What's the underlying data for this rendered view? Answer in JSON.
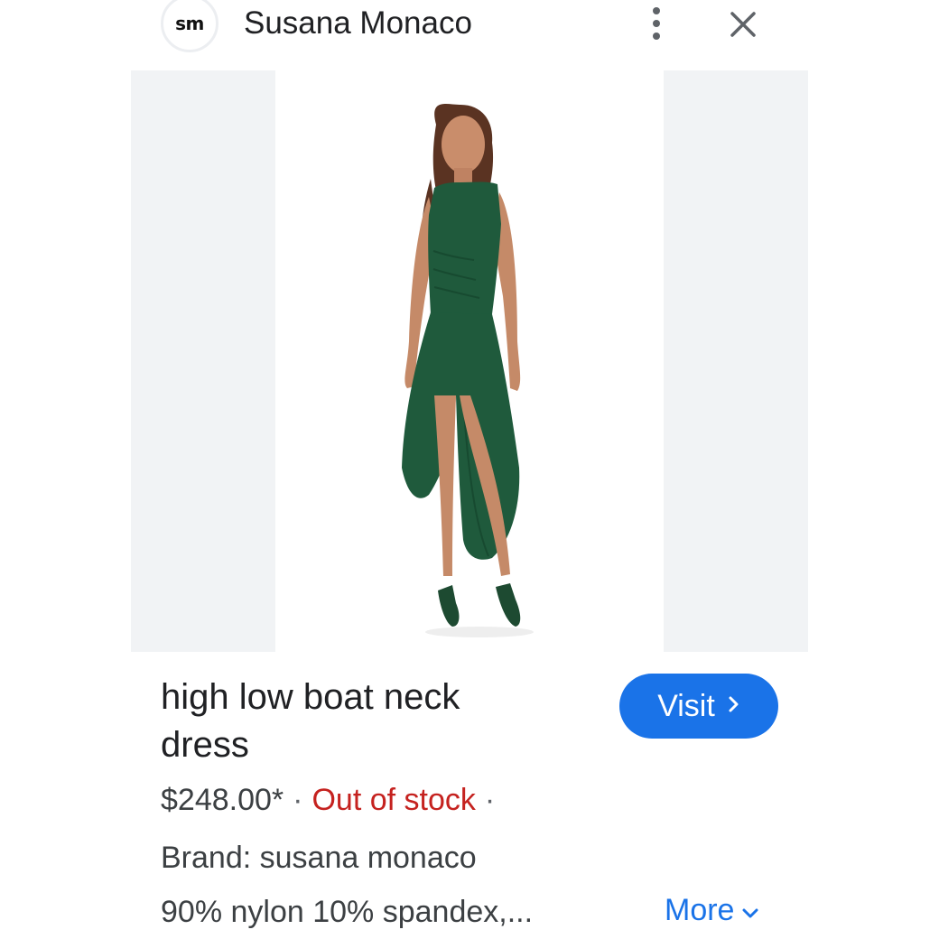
{
  "header": {
    "logo_text": "sm",
    "site_name": "Susana Monaco"
  },
  "product": {
    "title": "high low boat neck dress",
    "price": "$248.00*",
    "separator": "·",
    "availability": "Out of stock",
    "brand": "Brand: susana monaco",
    "materials": "90% nylon 10% spandex,...",
    "visit_label": "Visit",
    "more_label": "More"
  },
  "colors": {
    "accent": "#1a73e8",
    "out_of_stock": "#c5221f",
    "dress": "#1f5a3c",
    "panel": "#f1f3f5"
  },
  "icons": {
    "menu": "more-vert-icon",
    "close": "close-icon",
    "visit_chevron": "chevron-right-icon",
    "more_chevron": "chevron-down-icon"
  }
}
